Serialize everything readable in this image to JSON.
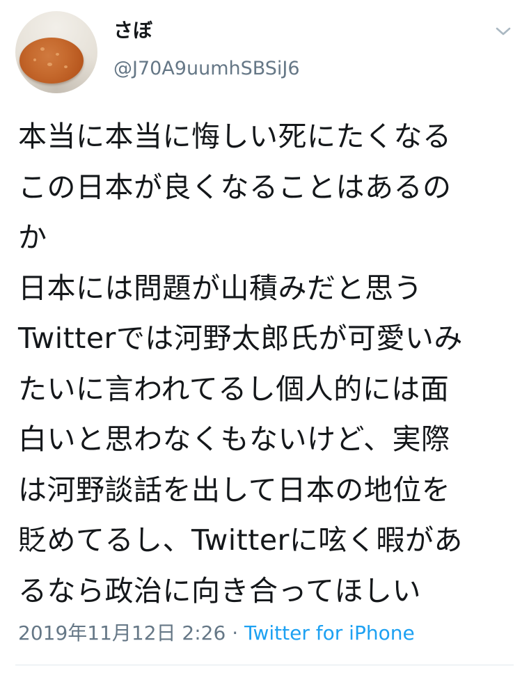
{
  "tweet": {
    "display_name": "さぼ",
    "handle": "@J70A9uumhSBSiJ6",
    "text": "本当に本当に悔しい死にたくなる\nこの日本が良くなることはあるの\nか\n日本には問題が山積みだと思う\nTwitterでは河野太郎氏が可愛いみ\nたいに言われてるし個人的には面\n白いと思わなくもないけど、実際\nは河野談話を出して日本の地位を\n貶めてるし、Twitterに呟く暇があ\nるなら政治に向き合ってほしい",
    "timestamp": "2019年11月12日 2:26",
    "separator": "·",
    "source": "Twitter for iPhone"
  },
  "icons": {
    "avatar": "pancake-photo",
    "menu": "chevron-down-icon"
  },
  "colors": {
    "text": "#14171a",
    "secondary": "#657786",
    "link": "#1da1f2",
    "divider": "#e1e8ed"
  }
}
